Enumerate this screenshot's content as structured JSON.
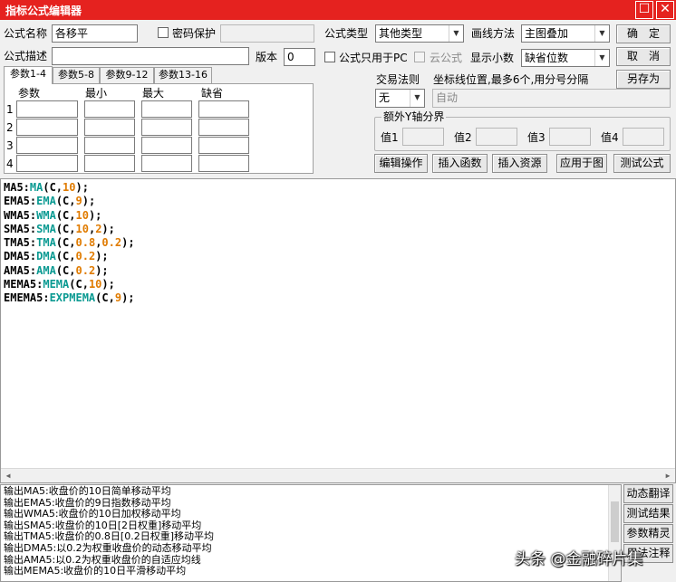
{
  "window": {
    "title": "指标公式编辑器",
    "maximize_glyph": "☐",
    "close_glyph": "✕"
  },
  "form": {
    "name_label": "公式名称",
    "name_value": "各移平",
    "password_label": "密码保护",
    "type_label": "公式类型",
    "type_value": "其他类型",
    "draw_label": "画线方法",
    "draw_value": "主图叠加",
    "desc_label": "公式描述",
    "desc_value": "",
    "version_label": "版本",
    "version_value": "0",
    "pc_only_label": "公式只用于PC",
    "cloud_label": "云公式",
    "decimals_label": "显示小数",
    "decimals_value": "缺省位数"
  },
  "buttons": {
    "ok": "确　定",
    "cancel": "取　消",
    "save_as": "另存为",
    "edit_op": "编辑操作",
    "insert_func": "插入函数",
    "insert_res": "插入资源",
    "apply_chart": "应用于图",
    "test_formula": "测试公式"
  },
  "tabs": [
    "参数1-4",
    "参数5-8",
    "参数9-12",
    "参数13-16"
  ],
  "param_headers": [
    "参数",
    "最小",
    "最大",
    "缺省"
  ],
  "param_rows": [
    "1",
    "2",
    "3",
    "4"
  ],
  "trade": {
    "label": "交易法则",
    "value": "无",
    "coord_label": "坐标线位置,最多6个,用分号分隔",
    "coord_placeholder": "自动"
  },
  "yaxis": {
    "title": "额外Y轴分界",
    "labels": [
      "值1",
      "值2",
      "值3",
      "值4"
    ]
  },
  "code_lines": [
    [
      [
        "v",
        "MA5:"
      ],
      [
        "f",
        "MA"
      ],
      [
        "p",
        "(C,"
      ],
      [
        "n",
        "10"
      ],
      [
        "p",
        ");"
      ]
    ],
    [
      [
        "v",
        "EMA5:"
      ],
      [
        "f",
        "EMA"
      ],
      [
        "p",
        "(C,"
      ],
      [
        "n",
        "9"
      ],
      [
        "p",
        ");"
      ]
    ],
    [
      [
        "v",
        "WMA5:"
      ],
      [
        "f",
        "WMA"
      ],
      [
        "p",
        "(C,"
      ],
      [
        "n",
        "10"
      ],
      [
        "p",
        ");"
      ]
    ],
    [
      [
        "v",
        "SMA5:"
      ],
      [
        "f",
        "SMA"
      ],
      [
        "p",
        "(C,"
      ],
      [
        "n",
        "10"
      ],
      [
        "p",
        ","
      ],
      [
        "n",
        "2"
      ],
      [
        "p",
        ");"
      ]
    ],
    [
      [
        "v",
        "TMA5:"
      ],
      [
        "f",
        "TMA"
      ],
      [
        "p",
        "(C,"
      ],
      [
        "n",
        "0.8"
      ],
      [
        "p",
        ","
      ],
      [
        "n",
        "0.2"
      ],
      [
        "p",
        ");"
      ]
    ],
    [
      [
        "v",
        "DMA5:"
      ],
      [
        "f",
        "DMA"
      ],
      [
        "p",
        "(C,"
      ],
      [
        "n",
        "0.2"
      ],
      [
        "p",
        ");"
      ]
    ],
    [
      [
        "v",
        "AMA5:"
      ],
      [
        "f",
        "AMA"
      ],
      [
        "p",
        "(C,"
      ],
      [
        "n",
        "0.2"
      ],
      [
        "p",
        ");"
      ]
    ],
    [
      [
        "v",
        "MEMA5:"
      ],
      [
        "f",
        "MEMA"
      ],
      [
        "p",
        "(C,"
      ],
      [
        "n",
        "10"
      ],
      [
        "p",
        ");"
      ]
    ],
    [
      [
        "v",
        "EMEMA5:"
      ],
      [
        "f",
        "EXPMEMA"
      ],
      [
        "p",
        "(C,"
      ],
      [
        "n",
        "9"
      ],
      [
        "p",
        ");"
      ]
    ]
  ],
  "output_lines": [
    "输出MA5:收盘价的10日简单移动平均",
    "输出EMA5:收盘价的9日指数移动平均",
    "输出WMA5:收盘价的10日加权移动平均",
    "输出SMA5:收盘价的10日[2日权重]移动平均",
    "输出TMA5:收盘价的0.8日[0.2日权重]移动平均",
    "输出DMA5:以0.2为权重收盘价的动态移动平均",
    "输出AMA5:以0.2为权重收盘价的自适应均线",
    "输出MEMA5:收盘价的10日平滑移动平均"
  ],
  "side_buttons": [
    "动态翻译",
    "测试结果",
    "参数精灵",
    "用法注释"
  ],
  "watermark": "头条 @金融碎片集",
  "colors": {
    "title_bar": "#e5221f",
    "func": "#0a9a92",
    "number": "#e07b00"
  }
}
